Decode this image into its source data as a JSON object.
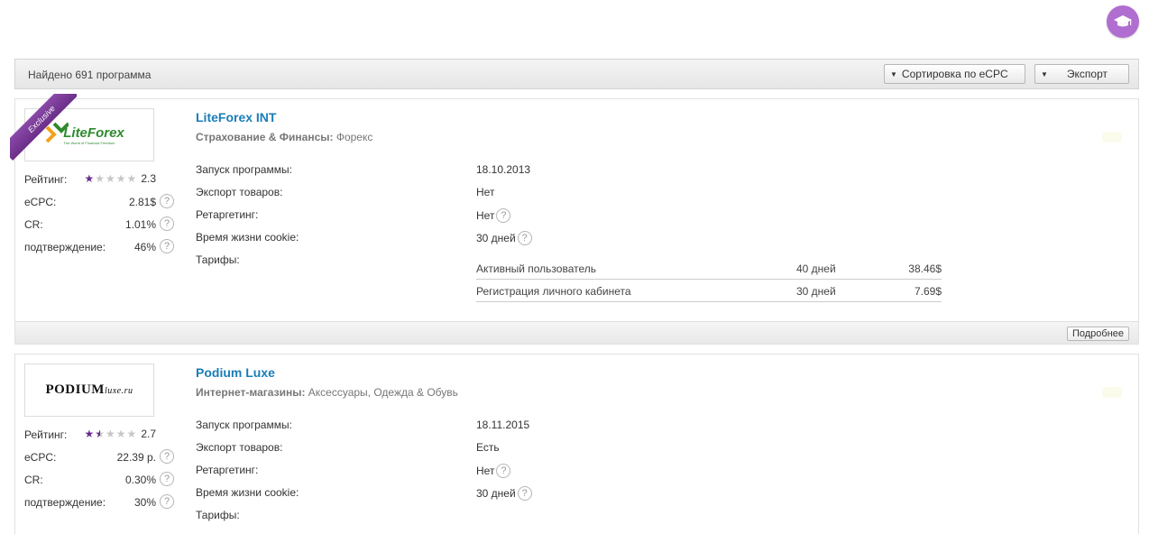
{
  "header": {
    "hat_icon": "graduation-cap-icon",
    "accent": "#b06ed0"
  },
  "toolbar": {
    "found_text": "Найдено 691 программа",
    "sort_label": "Сортировка по eCPC",
    "export_label": "Экспорт"
  },
  "programs": [
    {
      "badge": "Exclusive",
      "logo_text": "LiteForex",
      "logo_sub": "The World of Financial Freedom",
      "title": "LiteForex INT",
      "category_label": "Страхование & Финансы:",
      "category_value": "Форекс",
      "stats": {
        "rating_label": "Рейтинг:",
        "rating": "2.3",
        "rating_stars": 1,
        "ecpc_label": "eCPC:",
        "ecpc": "2.81$",
        "cr_label": "CR:",
        "cr": "1.01%",
        "confirm_label": "подтверждение:",
        "confirm": "46%"
      },
      "details": {
        "launch_label": "Запуск программы:",
        "launch": "18.10.2013",
        "export_label": "Экспорт товаров:",
        "export": "Нет",
        "retarget_label": "Ретаргетинг:",
        "retarget": "Нет",
        "cookie_label": "Время жизни cookie:",
        "cookie": "30 дней",
        "tariffs_label": "Тарифы:"
      },
      "tariffs": [
        {
          "name": "Активный пользователь",
          "days": "40 дней",
          "price": "38.46$"
        },
        {
          "name": "Регистрация личного кабинета",
          "days": "30 дней",
          "price": "7.69$"
        }
      ],
      "more_label": "Подробнее"
    },
    {
      "logo_text": "PODIUM",
      "logo_sub": "luxe.ru",
      "title": "Podium Luxe",
      "category_label": "Интернет-магазины:",
      "category_value": "Аксессуары, Одежда & Обувь",
      "stats": {
        "rating_label": "Рейтинг:",
        "rating": "2.7",
        "rating_stars": 1.5,
        "ecpc_label": "eCPC:",
        "ecpc": "22.39 р.",
        "cr_label": "CR:",
        "cr": "0.30%",
        "confirm_label": "подтверждение:",
        "confirm": "30%"
      },
      "details": {
        "launch_label": "Запуск программы:",
        "launch": "18.11.2015",
        "export_label": "Экспорт товаров:",
        "export": "Есть",
        "retarget_label": "Ретаргетинг:",
        "retarget": "Нет",
        "cookie_label": "Время жизни cookie:",
        "cookie": "30 дней",
        "tariffs_label": "Тарифы:"
      }
    }
  ],
  "colors": {
    "link": "#1a7db8",
    "star_on": "#6b2d8c",
    "star_off": "#c6c6c6"
  }
}
